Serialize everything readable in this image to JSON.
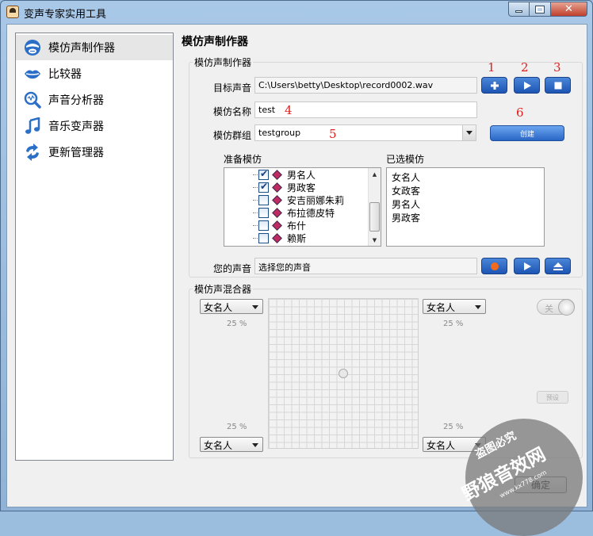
{
  "window": {
    "title": "变声专家实用工具"
  },
  "sidebar": {
    "items": [
      {
        "label": "模仿声制作器",
        "icon": "mimic-face-icon"
      },
      {
        "label": "比较器",
        "icon": "lips-icon"
      },
      {
        "label": "声音分析器",
        "icon": "magnifier-icon"
      },
      {
        "label": "音乐变声器",
        "icon": "music-note-icon"
      },
      {
        "label": "更新管理器",
        "icon": "refresh-arrows-icon"
      }
    ]
  },
  "main": {
    "title": "模仿声制作器",
    "maker": {
      "legend": "模仿声制作器",
      "target_label": "目标声音",
      "target_value": "C:\\Users\\betty\\Desktop\\record0002.wav",
      "name_label": "模仿名称",
      "name_value": "test",
      "group_label": "模仿群组",
      "group_value": "testgroup",
      "create_label": "创建",
      "annotations": [
        "1",
        "2",
        "3",
        "4",
        "5",
        "6"
      ],
      "ready_label": "准备模仿",
      "ready_items": [
        {
          "label": "男名人",
          "checked": true
        },
        {
          "label": "男政客",
          "checked": true
        },
        {
          "label": "安吉丽娜朱莉",
          "checked": false
        },
        {
          "label": "布拉德皮特",
          "checked": false
        },
        {
          "label": "布什",
          "checked": false
        },
        {
          "label": "赖斯",
          "checked": false
        }
      ],
      "selected_label": "已选模仿",
      "selected_items": [
        "女名人",
        "女政客",
        "男名人",
        "男政客"
      ],
      "your_voice_label": "您的声音",
      "your_voice_value": "选择您的声音"
    },
    "mixer": {
      "legend": "模仿声混合器",
      "top_left": "女名人",
      "top_right": "女名人",
      "bottom_left": "女名人",
      "bottom_right": "女名人",
      "pct_top_left": "25 %",
      "pct_top_right": "25 %",
      "pct_bottom_left": "25 %",
      "pct_bottom_right": "25 %",
      "toggle_label": "关",
      "preset_label": "预设"
    },
    "ok_label": "确定"
  },
  "watermark": {
    "line1": "盗图必究",
    "line2": "野狼音效网",
    "line3": "www.kx778.com"
  }
}
